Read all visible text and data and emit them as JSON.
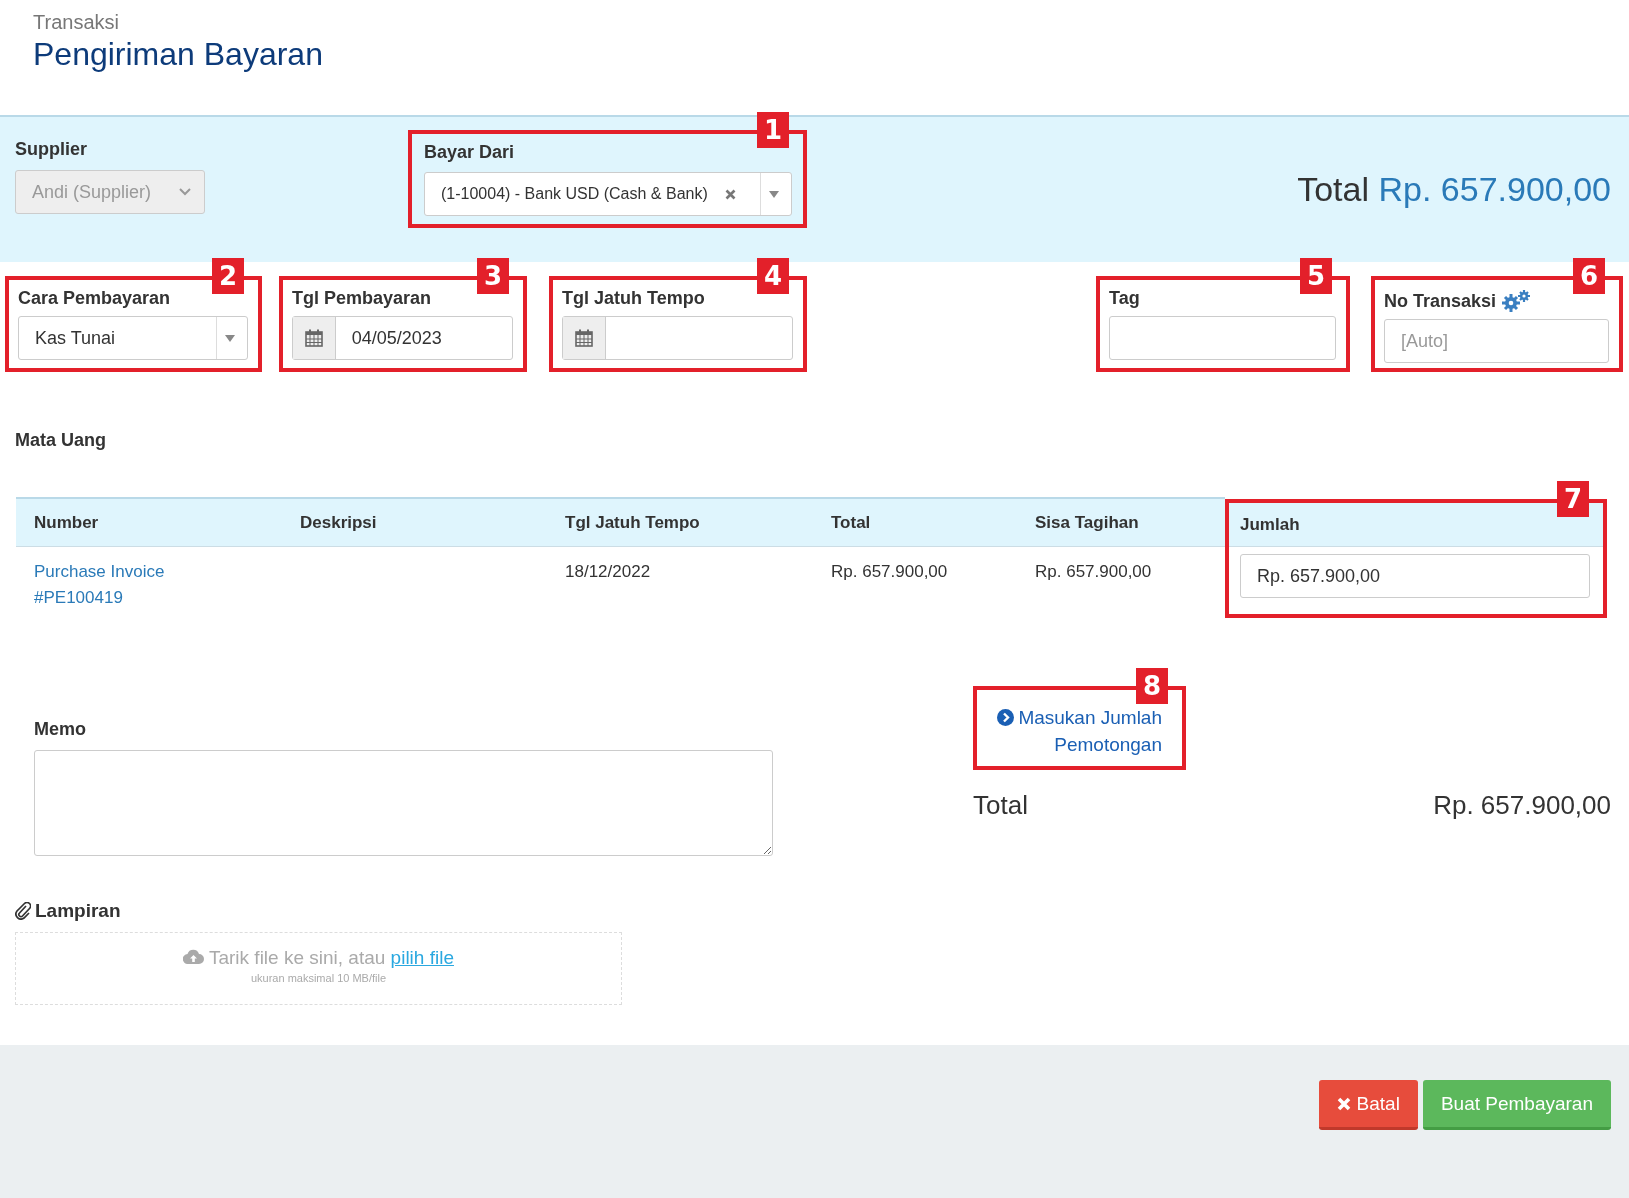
{
  "header": {
    "breadcrumb": "Transaksi",
    "title": "Pengiriman Bayaran"
  },
  "supplier": {
    "label": "Supplier",
    "value": "Andi (Supplier)",
    "disabled": true
  },
  "bayar_dari": {
    "label": "Bayar Dari",
    "value": "(1-10004) - Bank USD (Cash & Bank)",
    "callout": "1"
  },
  "total_header": {
    "label": "Total",
    "amount": "Rp. 657.900,00"
  },
  "cara_pembayaran": {
    "label": "Cara Pembayaran",
    "value": "Kas Tunai",
    "callout": "2"
  },
  "tgl_pembayaran": {
    "label": "Tgl Pembayaran",
    "value": "04/05/2023",
    "callout": "3"
  },
  "tgl_jatuh_tempo": {
    "label": "Tgl Jatuh Tempo",
    "callout": "4"
  },
  "tag": {
    "label": "Tag",
    "callout": "5"
  },
  "no_transaksi": {
    "label": "No Transaksi",
    "placeholder": "[Auto]",
    "callout": "6"
  },
  "mata_uang": {
    "label": "Mata Uang"
  },
  "table": {
    "columns": [
      "Number",
      "Deskripsi",
      "Tgl Jatuh Tempo",
      "Total",
      "Sisa Tagihan",
      "Jumlah"
    ],
    "jumlah_callout": "7",
    "rows": [
      {
        "number": "Purchase Invoice #PE100419",
        "tgl_jatuh_tempo": "18/12/2022",
        "total": "Rp. 657.900,00",
        "sisa_tagihan": "Rp. 657.900,00",
        "jumlah": "Rp. 657.900,00"
      }
    ]
  },
  "memo": {
    "label": "Memo"
  },
  "deduction_link": {
    "label": "Masukan Jumlah Pemotongan",
    "callout": "8"
  },
  "summary_total": {
    "label": "Total",
    "amount": "Rp. 657.900,00"
  },
  "lampiran": {
    "label": "Lampiran",
    "drop_text": "Tarik file ke sini, atau",
    "link": "pilih file",
    "hint": "ukuran maksimal 10 MB/file"
  },
  "buttons": [
    {
      "label": "Batal",
      "kind": "cancel"
    },
    {
      "label": "Buat Pembayaran",
      "kind": "submit"
    }
  ]
}
